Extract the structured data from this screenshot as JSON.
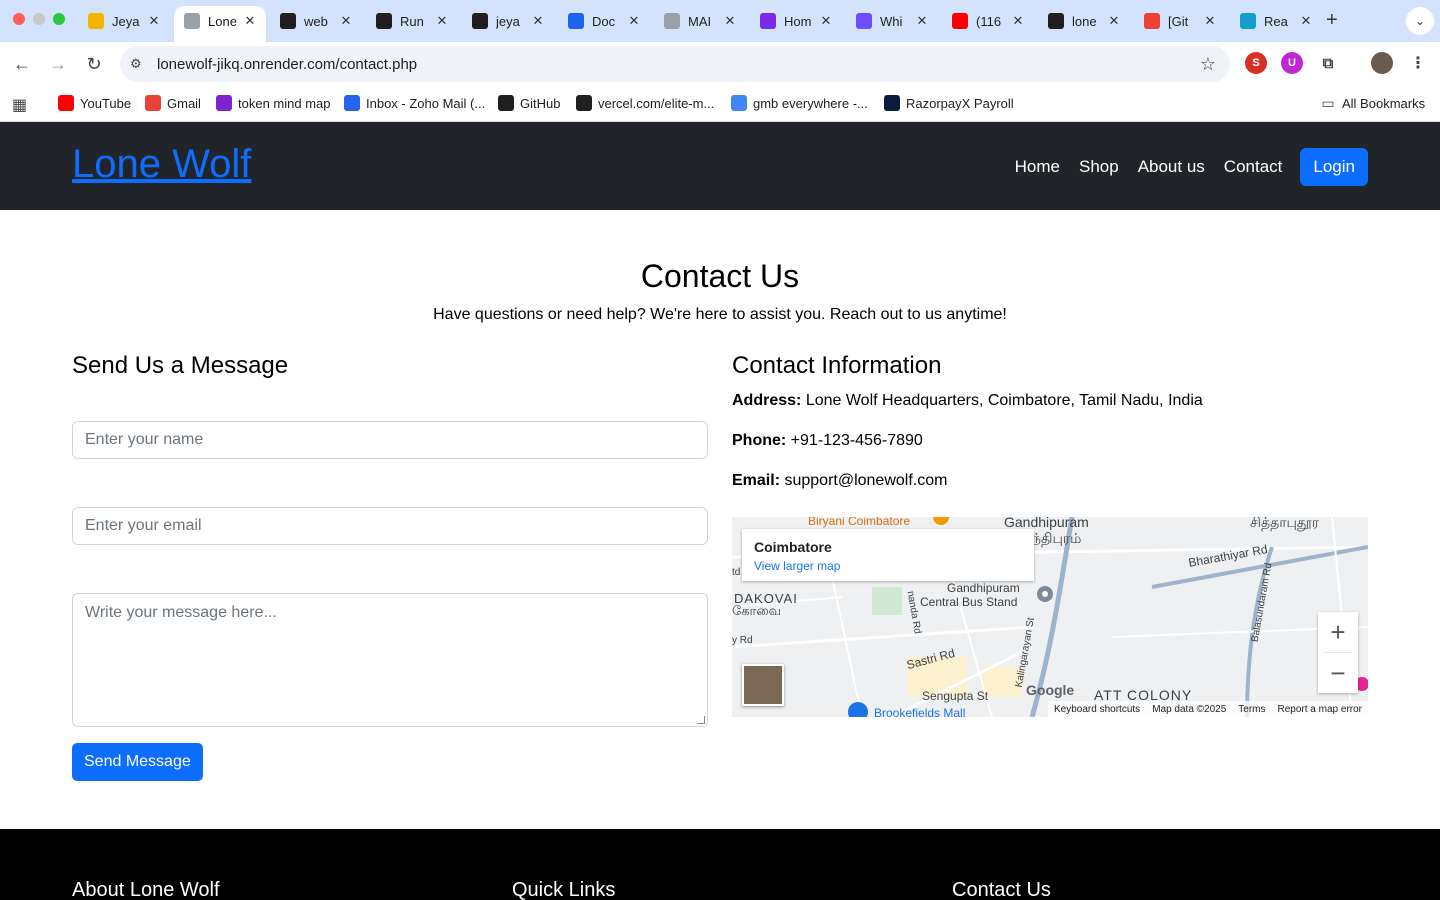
{
  "browser": {
    "tabs": [
      {
        "label": "Jeya",
        "icon": "jb-icon",
        "color": "#f5b400"
      },
      {
        "label": "Lone",
        "icon": "globe-icon",
        "color": "#9aa0a6",
        "active": true
      },
      {
        "label": "web",
        "icon": "render-icon",
        "color": "#1f1f1f"
      },
      {
        "label": "Run",
        "icon": "openai-icon",
        "color": "#1f1f1f"
      },
      {
        "label": "jeya",
        "icon": "github-icon",
        "color": "#1f1f1f"
      },
      {
        "label": "Doc",
        "icon": "docker-icon",
        "color": "#1d63ed"
      },
      {
        "label": "MAI",
        "icon": "globe-icon",
        "color": "#9aa0a6"
      },
      {
        "label": "Hom",
        "icon": "canva-icon",
        "color": "#7d2ae8"
      },
      {
        "label": "Whi",
        "icon": "chat-icon",
        "color": "#6b4eff"
      },
      {
        "label": "(116",
        "icon": "youtube-icon",
        "color": "#ff0000"
      },
      {
        "label": "lone",
        "icon": "render-icon",
        "color": "#1f1f1f"
      },
      {
        "label": "[Git",
        "icon": "gmail-icon",
        "color": "#ea4335"
      },
      {
        "label": "Rea",
        "icon": "react-icon",
        "color": "#149eca"
      }
    ],
    "url": "lonewolf-jikq.onrender.com/contact.php",
    "bookmarks": [
      {
        "label": "YouTube",
        "icon": "youtube-icon",
        "color": "#ff0000"
      },
      {
        "label": "Gmail",
        "icon": "gmail-icon",
        "color": "#ea4335"
      },
      {
        "label": "token mind map",
        "icon": "mindmap-icon",
        "color": "#7e22ce"
      },
      {
        "label": "Inbox - Zoho Mail (...",
        "icon": "zoho-mail-icon",
        "color": "#2563eb"
      },
      {
        "label": "GitHub",
        "icon": "github-icon",
        "color": "#1f1f1f"
      },
      {
        "label": "vercel.com/elite-m...",
        "icon": "vercel-icon",
        "color": "#1f1f1f"
      },
      {
        "label": "gmb everywhere -...",
        "icon": "google-icon",
        "color": "#4285f4"
      },
      {
        "label": "RazorpayX Payroll",
        "icon": "razorpay-icon",
        "color": "#0b1b3f"
      }
    ],
    "all_bookmarks": "All Bookmarks"
  },
  "nav": {
    "brand": "Lone Wolf",
    "links": [
      "Home",
      "Shop",
      "About us",
      "Contact"
    ],
    "login": "Login"
  },
  "hero": {
    "title": "Contact Us",
    "subtitle": "Have questions or need help? We're here to assist you. Reach out to us anytime!"
  },
  "form": {
    "title": "Send Us a Message",
    "name_placeholder": "Enter your name",
    "email_placeholder": "Enter your email",
    "message_placeholder": "Write your message here...",
    "submit": "Send Message"
  },
  "info": {
    "title": "Contact Information",
    "address_label": "Address:",
    "address": "Lone Wolf Headquarters, Coimbatore, Tamil Nadu, India",
    "phone_label": "Phone:",
    "phone": "+91-123-456-7890",
    "email_label": "Email:",
    "email": "support@lonewolf.com"
  },
  "map": {
    "place": "Coimbatore",
    "larger_link": "View larger map",
    "labels": {
      "biryani": "Biryani Coimbatore",
      "gandhipuram": "Gandhipuram",
      "gandhipuram_ta": "ந்திபுரம்",
      "sathy_ta": "சித்தாபுதூர",
      "bharathiyar": "Bharathiyar Rd",
      "bus_stand_1": "Gandhipuram",
      "bus_stand_2": "Central Bus Stand",
      "dakovai": "DAKOVAI",
      "kovai_ta": "கோவை",
      "sastri": "Sastri Rd",
      "sengupta": "Sengupta St",
      "brookefields": "Brookefields Mall",
      "att_colony": "ATT COLONY",
      "kalingarayan": "Kalingarayan St",
      "balasundaram": "Balasundaram Rd",
      "nanda": "nanda Rd",
      "y_rd": "y Rd",
      "td": "td"
    },
    "google": "Google",
    "footer": [
      "Keyboard shortcuts",
      "Map data ©2025",
      "Terms",
      "Report a map error"
    ]
  },
  "footer": {
    "about": "About Lone Wolf",
    "quick_links": "Quick Links",
    "contact": "Contact Us"
  }
}
